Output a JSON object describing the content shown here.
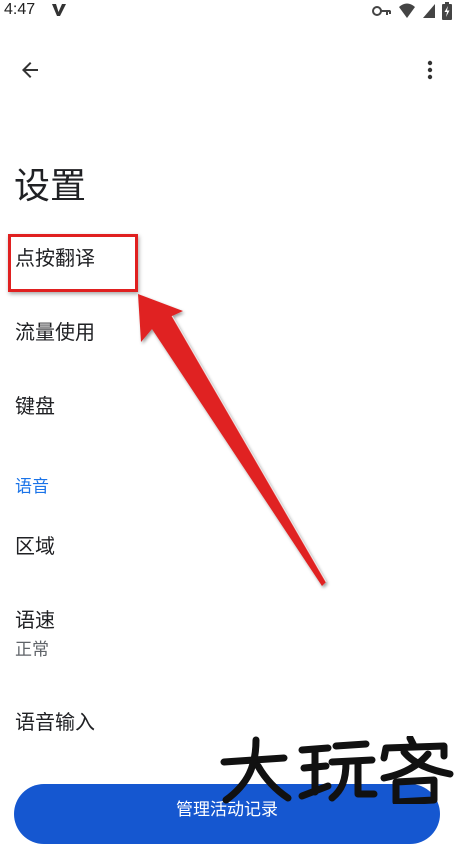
{
  "status_bar": {
    "time": "4:47",
    "icons": [
      "v-icon",
      "key-icon",
      "wifi-icon",
      "cell-signal-icon",
      "battery-charging-icon"
    ]
  },
  "app_bar": {
    "back_icon": "arrow-left-icon",
    "more_icon": "more-vert-icon"
  },
  "page": {
    "title": "设置"
  },
  "settings": {
    "items": [
      {
        "title": "点按翻译"
      },
      {
        "title": "流量使用"
      },
      {
        "title": "键盘"
      }
    ],
    "speech_section": {
      "header": "语音",
      "items": [
        {
          "title": "区域"
        },
        {
          "title": "语速",
          "summary": "正常"
        },
        {
          "title": "语音输入"
        }
      ]
    }
  },
  "footer": {
    "manage_button_label": "管理活动记录"
  },
  "annotation": {
    "highlight_color": "#e02020",
    "arrow_color": "#e02020"
  },
  "colors": {
    "accent": "#1a73e8",
    "button": "#1557d0",
    "text": "#202124",
    "secondary_text": "#5f6368"
  }
}
